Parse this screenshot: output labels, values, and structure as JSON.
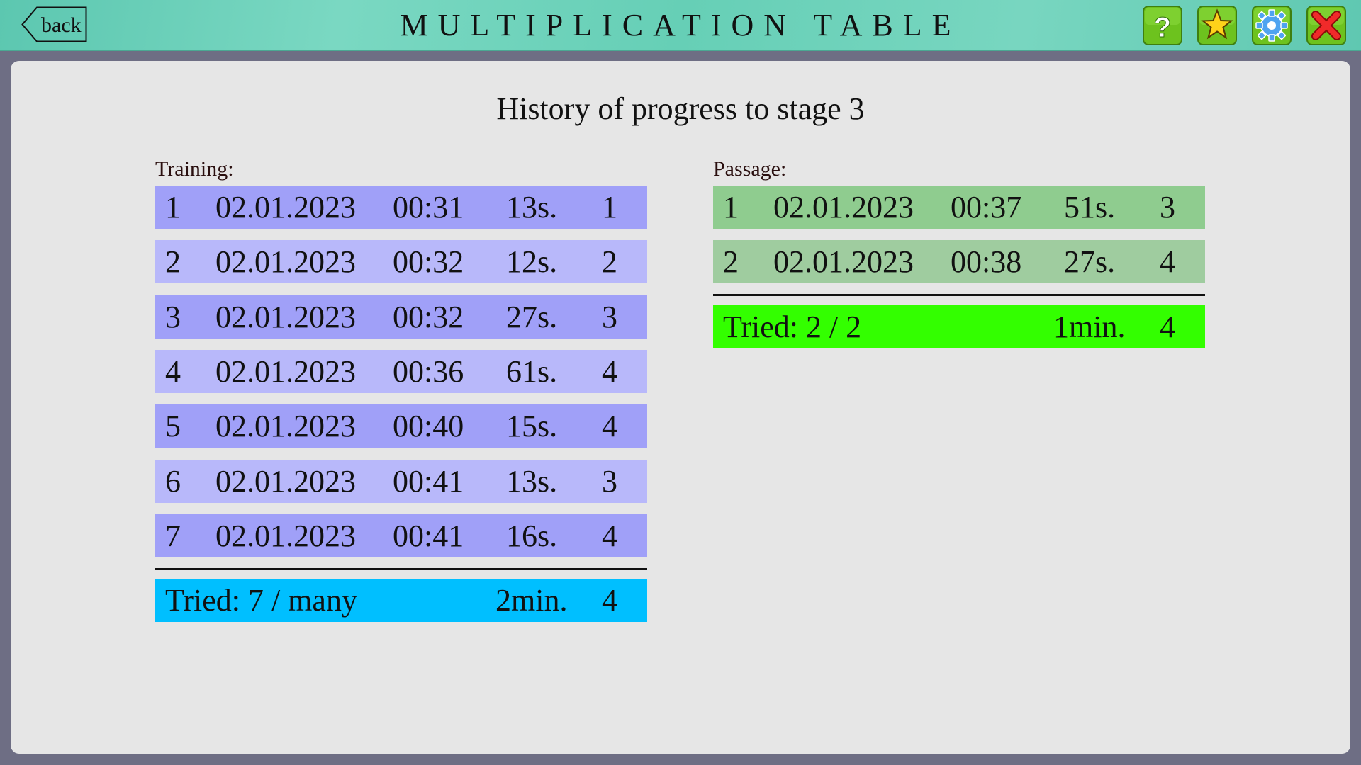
{
  "header": {
    "back_label": "back",
    "title": "MULTIPLICATION TABLE",
    "buttons": [
      {
        "name": "help-button",
        "icon": "question-mark-icon",
        "color": "#6dc21e"
      },
      {
        "name": "favorites-button",
        "icon": "star-icon",
        "color": "#6dc21e"
      },
      {
        "name": "settings-button",
        "icon": "gear-icon",
        "color": "#6dc21e"
      },
      {
        "name": "close-button",
        "icon": "close-icon",
        "color": "#6dc21e"
      }
    ]
  },
  "page": {
    "title": "History of progress to stage 3"
  },
  "training": {
    "label": "Training:",
    "rows": [
      {
        "num": "1",
        "date": "02.01.2023",
        "time": "00:31",
        "duration": "13s.",
        "score": "1"
      },
      {
        "num": "2",
        "date": "02.01.2023",
        "time": "00:32",
        "duration": "12s.",
        "score": "2"
      },
      {
        "num": "3",
        "date": "02.01.2023",
        "time": "00:32",
        "duration": "27s.",
        "score": "3"
      },
      {
        "num": "4",
        "date": "02.01.2023",
        "time": "00:36",
        "duration": "61s.",
        "score": "4"
      },
      {
        "num": "5",
        "date": "02.01.2023",
        "time": "00:40",
        "duration": "15s.",
        "score": "4"
      },
      {
        "num": "6",
        "date": "02.01.2023",
        "time": "00:41",
        "duration": "13s.",
        "score": "3"
      },
      {
        "num": "7",
        "date": "02.01.2023",
        "time": "00:41",
        "duration": "16s.",
        "score": "4"
      }
    ],
    "summary": {
      "tried": "Tried: 7 / many",
      "total_time": "2min.",
      "score": "4"
    },
    "colors": {
      "row_dark": "#a0a0f8",
      "row_light": "#b8b8fa",
      "summary": "#00bfff"
    }
  },
  "passage": {
    "label": "Passage:",
    "rows": [
      {
        "num": "1",
        "date": "02.01.2023",
        "time": "00:37",
        "duration": "51s.",
        "score": "3"
      },
      {
        "num": "2",
        "date": "02.01.2023",
        "time": "00:38",
        "duration": "27s.",
        "score": "4"
      }
    ],
    "summary": {
      "tried": "Tried: 2 / 2",
      "total_time": "1min.",
      "score": "4"
    },
    "colors": {
      "row_dark": "#8fcc8f",
      "row_light": "#9fcc9f",
      "summary": "#33ff00"
    }
  }
}
